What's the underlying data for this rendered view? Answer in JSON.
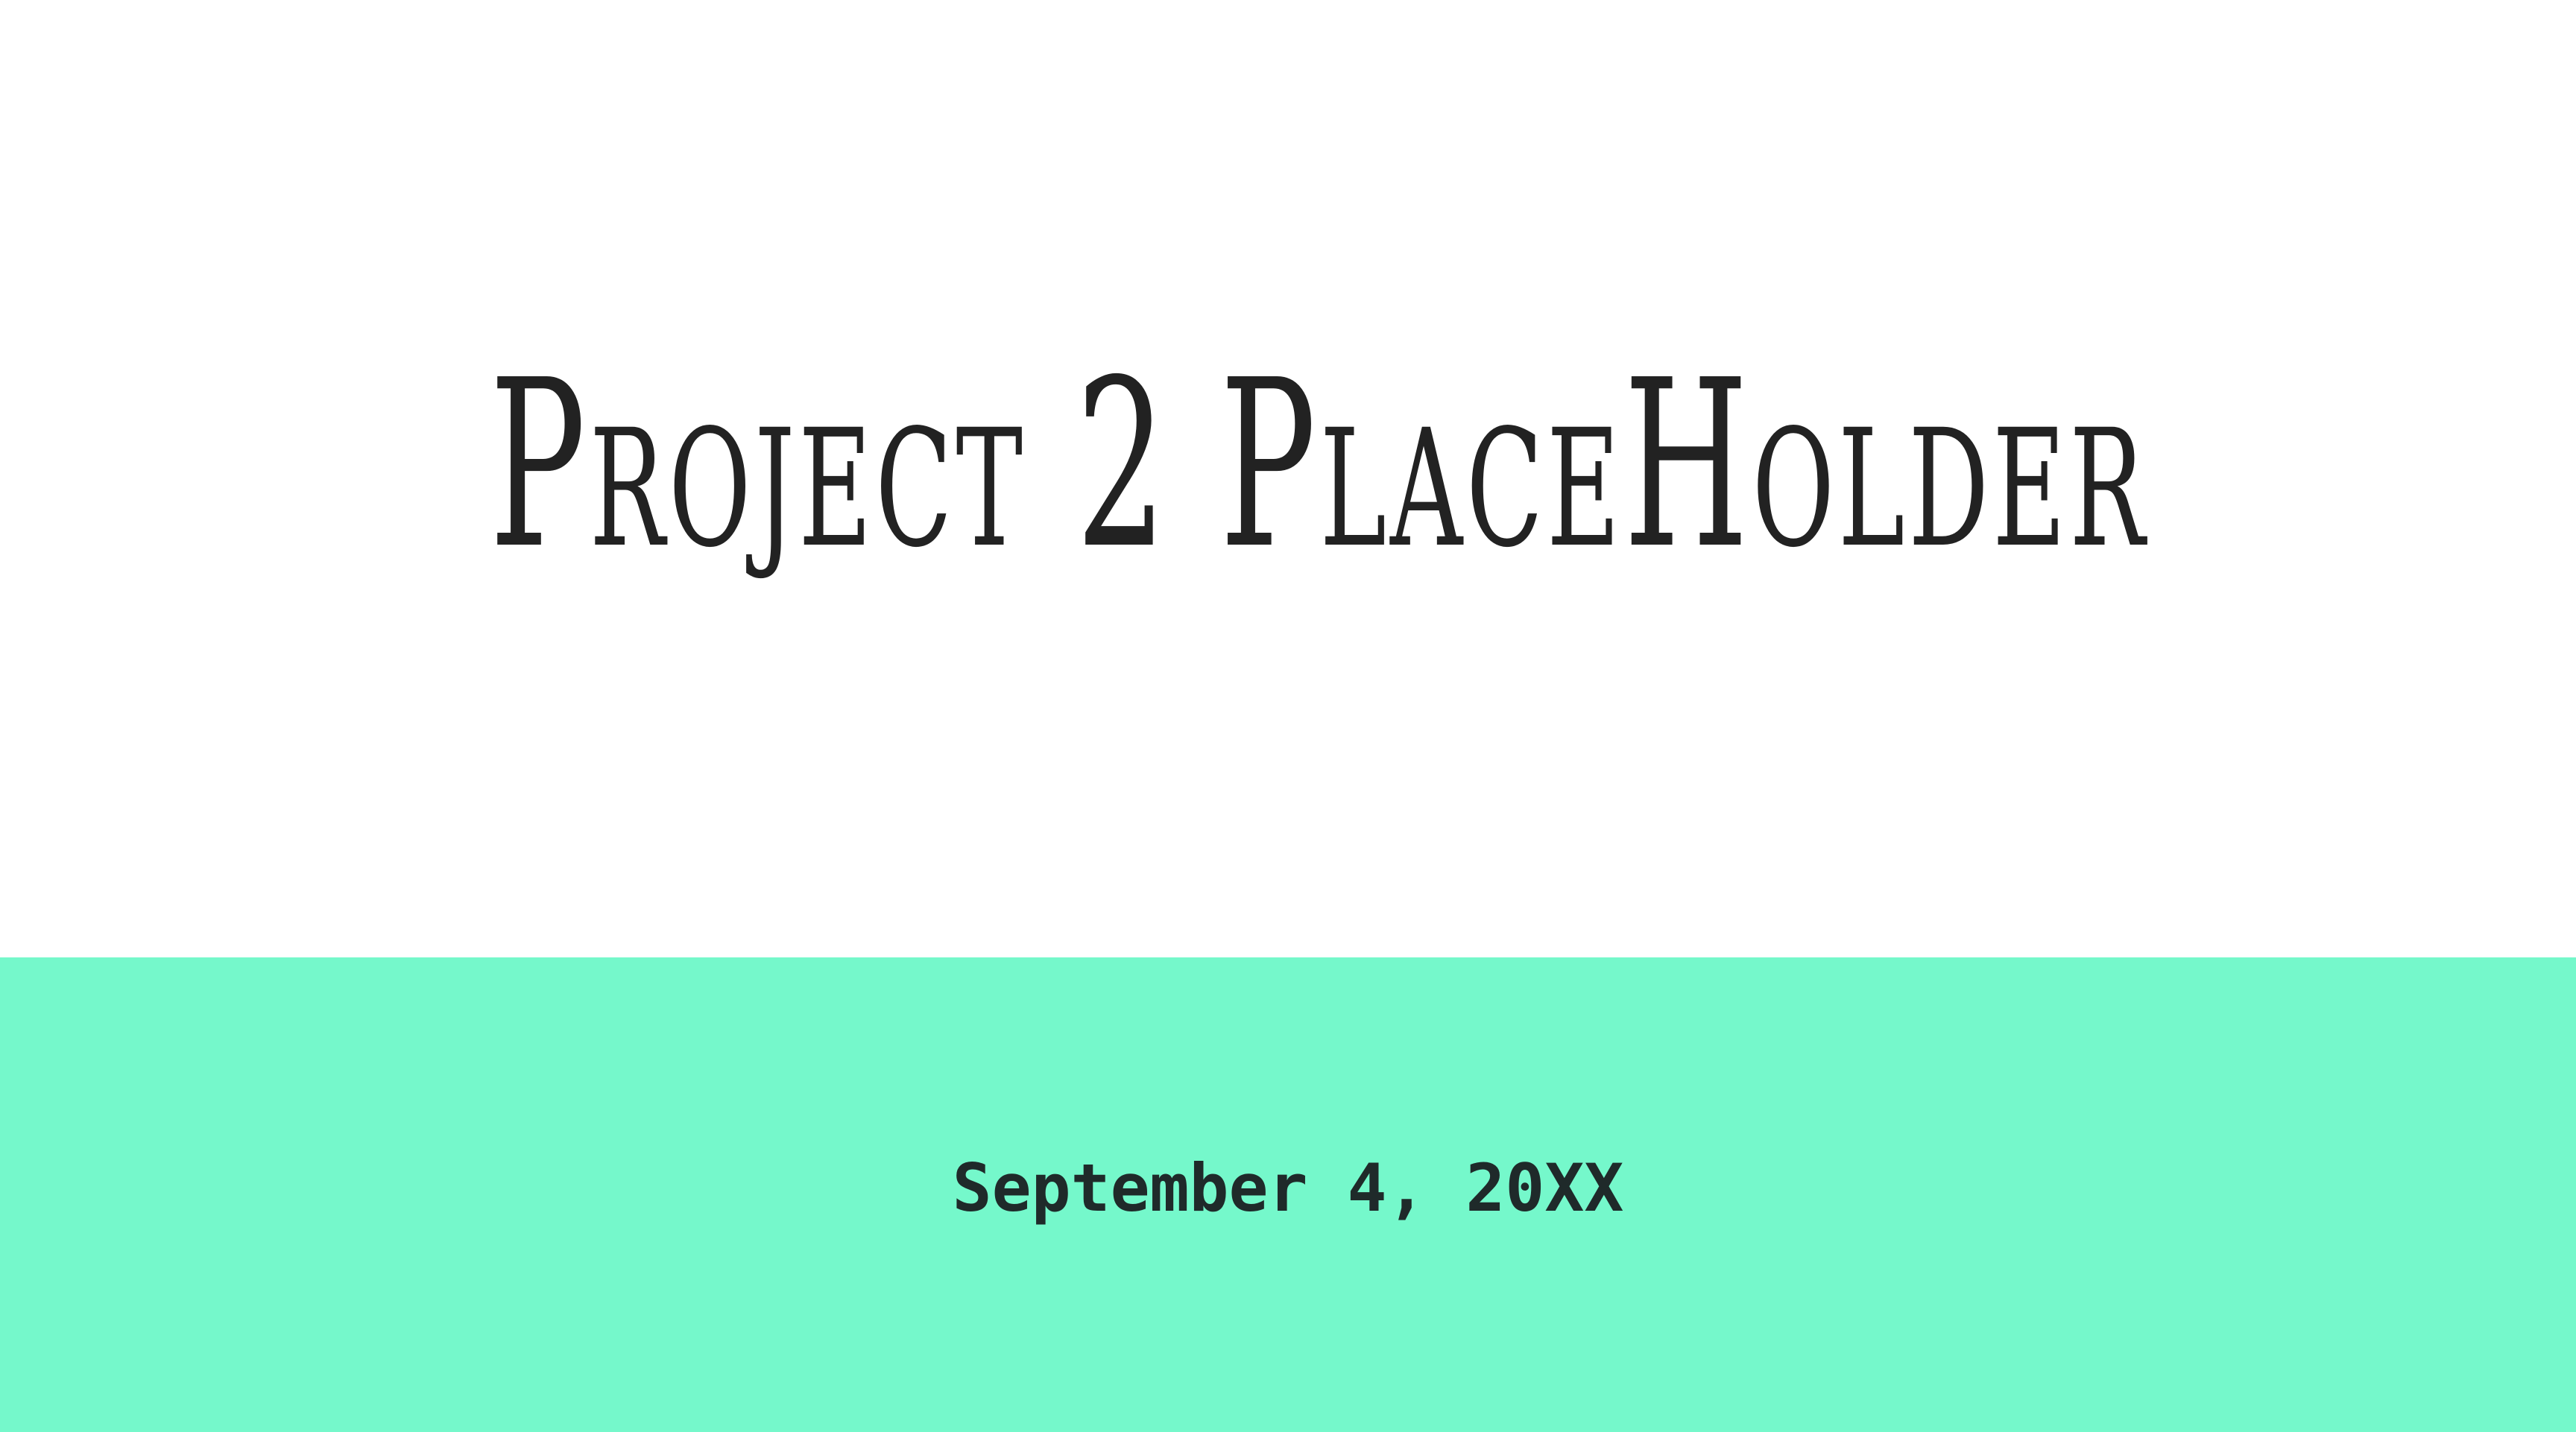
{
  "slide": {
    "title": "Project 2 PlaceHolder",
    "subtitle": "September 4, 20XX"
  },
  "colors": {
    "background": "#ffffff",
    "accent_band": "#75f8cb",
    "title_text": "#222222",
    "subtitle_text": "#1f2a2a"
  }
}
